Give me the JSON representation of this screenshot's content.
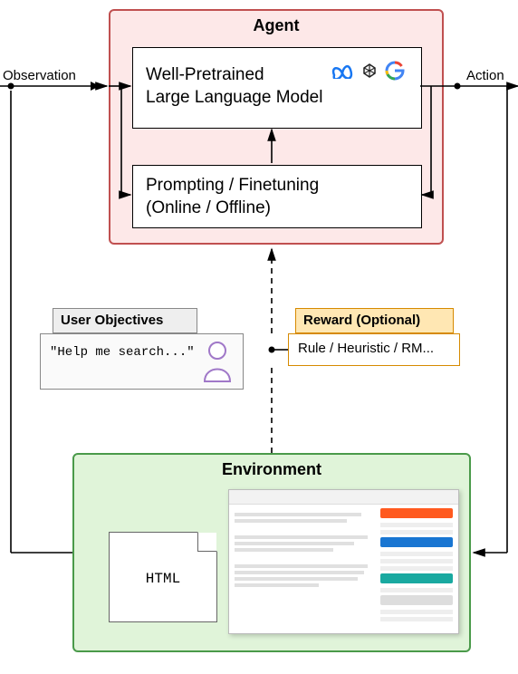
{
  "agent": {
    "title": "Agent",
    "llm_line1": "Well-Pretrained",
    "llm_line2": "Large Language Model",
    "prompt_line1": "Prompting / Finetuning",
    "prompt_line2": "(Online / Offline)",
    "logos": [
      "meta-logo",
      "openai-logo",
      "google-logo"
    ]
  },
  "edges": {
    "observation": "Observation",
    "action": "Action"
  },
  "user_objectives": {
    "title": "User Objectives",
    "example": "\"Help me search...\""
  },
  "reward": {
    "title": "Reward (Optional)",
    "body": "Rule / Heuristic / RM..."
  },
  "environment": {
    "title": "Environment",
    "html_label": "HTML"
  }
}
